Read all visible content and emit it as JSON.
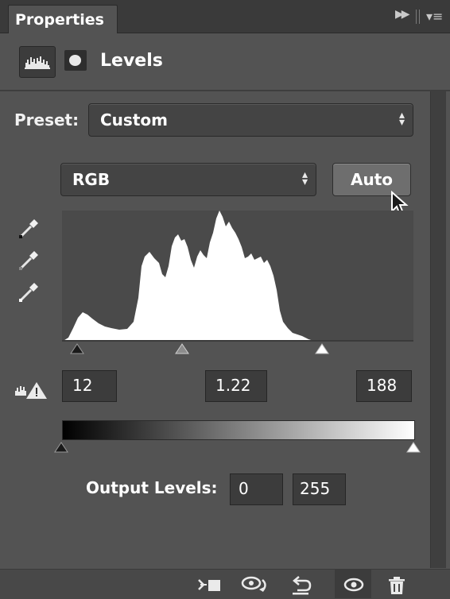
{
  "panel": {
    "tab_label": "Properties",
    "title": "Levels"
  },
  "preset": {
    "label": "Preset:",
    "value": "Custom"
  },
  "channel": {
    "value": "RGB"
  },
  "auto_button": {
    "label": "Auto"
  },
  "input_levels": {
    "black": "12",
    "gamma": "1.22",
    "white": "188"
  },
  "output_levels": {
    "label": "Output Levels:",
    "black": "0",
    "white": "255"
  },
  "icons": {
    "tab_menu": [
      "collapse-icon",
      "panel-menu-icon"
    ],
    "header": [
      "levels-histogram-icon",
      "mask-icon"
    ],
    "droppers": [
      "black-point-eyedropper-icon",
      "gray-point-eyedropper-icon",
      "white-point-eyedropper-icon"
    ],
    "warning": "clipping-warning-icon",
    "bottom": [
      "clip-to-layer-icon",
      "view-previous-state-icon",
      "reset-icon",
      "toggle-visibility-icon",
      "delete-icon"
    ]
  },
  "colors": {
    "panel_bg": "#535353",
    "histogram_bg": "#4a4a4a",
    "histogram_fill": "#ffffff"
  }
}
